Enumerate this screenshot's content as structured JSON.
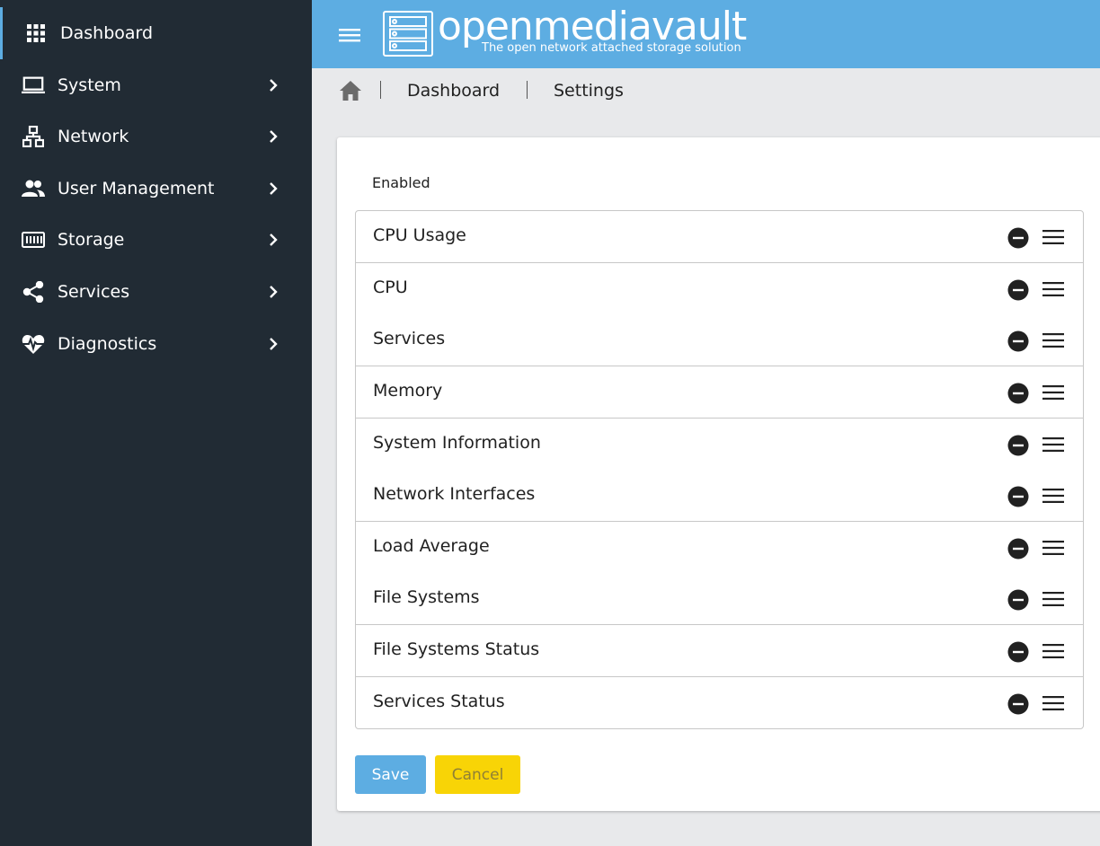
{
  "sidebar": {
    "items": [
      {
        "label": "Dashboard",
        "icon": "apps-grid-icon"
      },
      {
        "label": "System",
        "icon": "laptop-icon"
      },
      {
        "label": "Network",
        "icon": "network-icon"
      },
      {
        "label": "User Management",
        "icon": "users-icon"
      },
      {
        "label": "Storage",
        "icon": "storage-icon"
      },
      {
        "label": "Services",
        "icon": "share-icon"
      },
      {
        "label": "Diagnostics",
        "icon": "heart-pulse-icon"
      }
    ]
  },
  "header": {
    "logo_text": "openmediavault",
    "logo_subtitle": "The open network attached storage solution"
  },
  "breadcrumb": {
    "items": [
      "Dashboard",
      "Settings"
    ]
  },
  "card": {
    "section_label": "Enabled",
    "widgets": [
      {
        "label": "CPU Usage"
      },
      {
        "label": "CPU"
      },
      {
        "label": "Services"
      },
      {
        "label": "Memory"
      },
      {
        "label": "System Information"
      },
      {
        "label": "Network Interfaces"
      },
      {
        "label": "Load Average"
      },
      {
        "label": "File Systems"
      },
      {
        "label": "File Systems Status"
      },
      {
        "label": "Services Status"
      }
    ],
    "save_label": "Save",
    "cancel_label": "Cancel"
  },
  "colors": {
    "sidebar_bg": "#212b34",
    "header_bg": "#5dade2",
    "save_button": "#5dade2",
    "cancel_button": "#f8d406"
  }
}
